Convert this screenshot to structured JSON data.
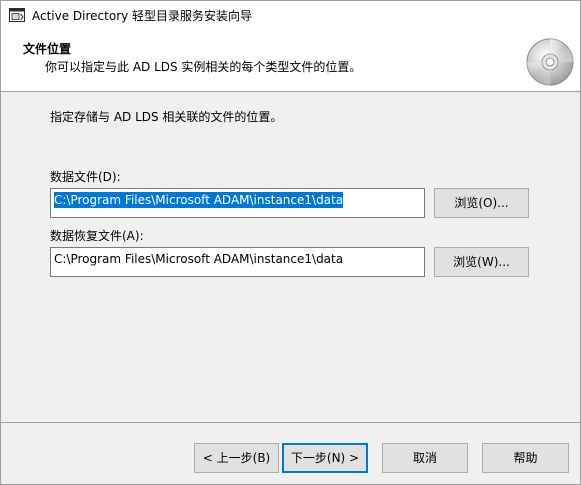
{
  "window": {
    "title": "Active Directory 轻型目录服务安装向导",
    "app_icon": "wizard-window-icon"
  },
  "header": {
    "title": "文件位置",
    "subtitle": "你可以指定与此 AD LDS 实例相关的每个类型文件的位置。",
    "icon": "disc-icon"
  },
  "content": {
    "instruction": "指定存储与 AD LDS 相关联的文件的位置。",
    "data_files": {
      "label": "数据文件(D):",
      "value": "C:\\Program Files\\Microsoft ADAM\\instance1\\data",
      "browse_label": "浏览(O)..."
    },
    "recovery_files": {
      "label": "数据恢复文件(A):",
      "value": "C:\\Program Files\\Microsoft ADAM\\instance1\\data",
      "browse_label": "浏览(W)..."
    }
  },
  "footer": {
    "back_label": "< 上一步(B)",
    "next_label": "下一步(N) >",
    "cancel_label": "取消",
    "help_label": "帮助"
  },
  "colors": {
    "selection": "#0078d7",
    "focus_border": "#0078d7",
    "button_face": "#e1e1e1",
    "dialog_bg": "#f0f0f0"
  }
}
